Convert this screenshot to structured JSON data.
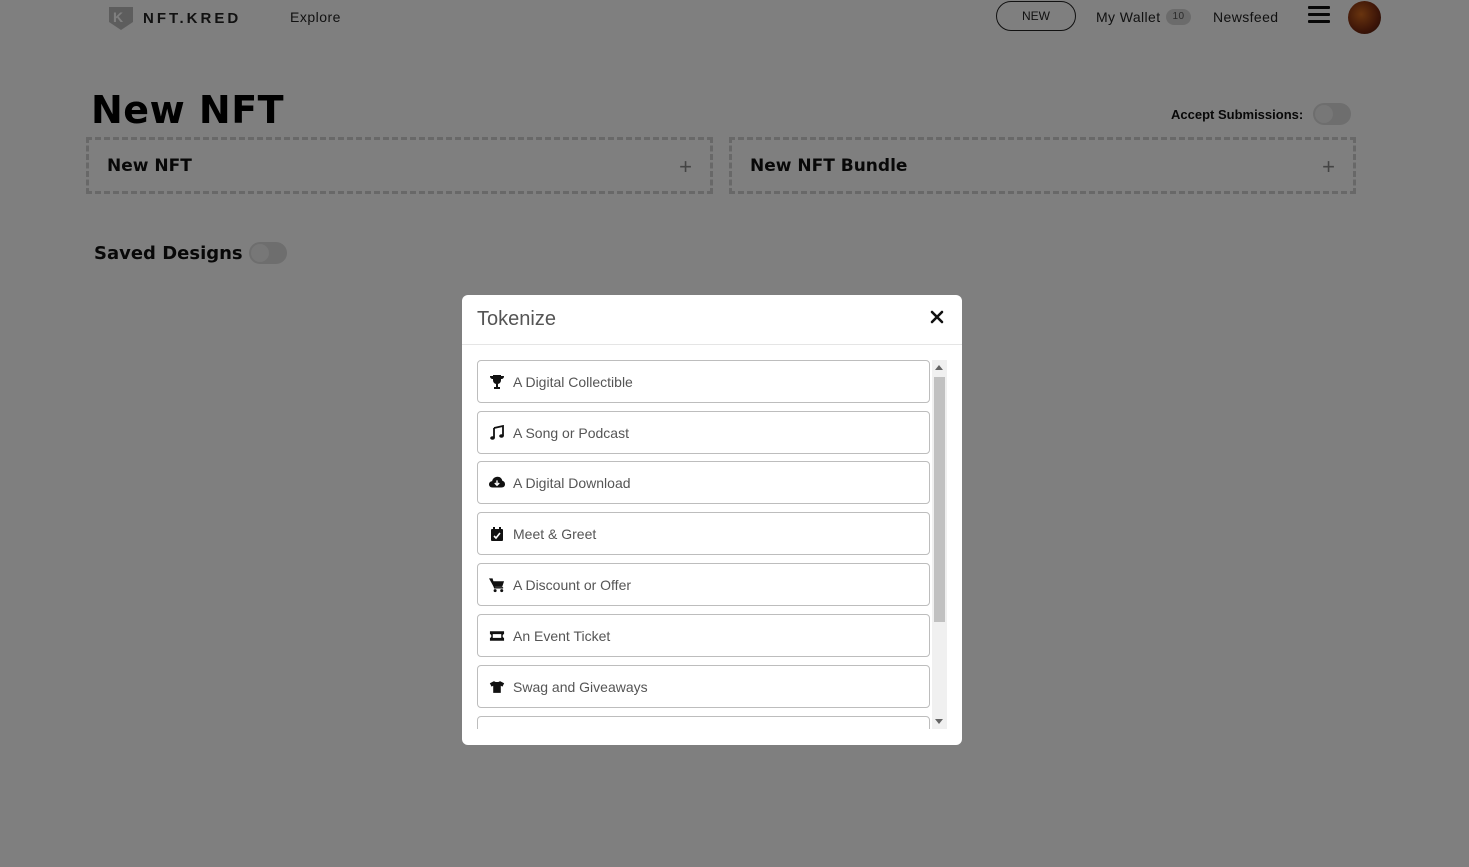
{
  "header": {
    "logo_text": "NFT.KRED",
    "nav_explore": "Explore",
    "new_button": "NEW",
    "wallet_label": "My Wallet",
    "wallet_count": "10",
    "newsfeed": "Newsfeed"
  },
  "page": {
    "title": "New NFT",
    "accept_label": "Accept Submissions:",
    "cards": [
      {
        "label": "New NFT"
      },
      {
        "label": "New NFT Bundle"
      }
    ],
    "saved_label": "Saved Designs"
  },
  "modal": {
    "title": "Tokenize",
    "options": [
      {
        "label": "A Digital Collectible",
        "icon": "trophy-icon"
      },
      {
        "label": "A Song or Podcast",
        "icon": "music-icon"
      },
      {
        "label": "A Digital Download",
        "icon": "cloud-download-icon"
      },
      {
        "label": "Meet & Greet",
        "icon": "calendar-check-icon"
      },
      {
        "label": "A Discount or Offer",
        "icon": "cart-icon"
      },
      {
        "label": "An Event Ticket",
        "icon": "ticket-icon"
      },
      {
        "label": "Swag and Giveaways",
        "icon": "tshirt-icon"
      }
    ]
  }
}
